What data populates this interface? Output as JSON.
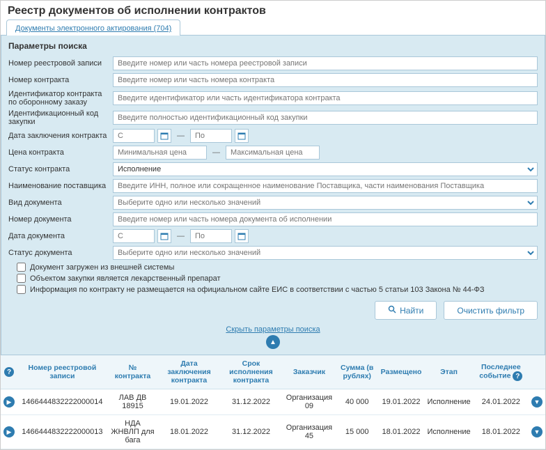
{
  "page_title": "Реестр документов об исполнении контрактов",
  "tab": {
    "label": "Документы электронного актирования (704)"
  },
  "search": {
    "heading": "Параметры поиска",
    "labels": {
      "registry_no": "Номер реестровой записи",
      "contract_no": "Номер контракта",
      "defense_id": "Идентификатор контракта по оборонному заказу",
      "purchase_code": "Идентификационный код закупки",
      "contract_date": "Дата заключения контракта",
      "price": "Цена контракта",
      "contract_status": "Статус контракта",
      "supplier": "Наименование поставщика",
      "doc_type": "Вид документа",
      "doc_no": "Номер документа",
      "doc_date": "Дата документа",
      "doc_status": "Статус документа"
    },
    "placeholders": {
      "registry_no": "Введите номер или часть номера реестровой записи",
      "contract_no": "Введите номер или часть номера контракта",
      "defense_id": "Введите идентификатор или часть идентификатора контракта",
      "purchase_code": "Введите полностью идентификационный код закупки",
      "date_from": "С",
      "date_to": "По",
      "price_min": "Минимальная цена",
      "price_max": "Максимальная цена",
      "supplier": "Введите ИНН, полное или сокращенное наименование Поставщика, части наименования Поставщика",
      "multi_select": "Выберите одно или несколько значений",
      "doc_no": "Введите номер или часть номера документа об исполнении"
    },
    "values": {
      "contract_status": "Исполнение"
    },
    "checkboxes": {
      "external": "Документ загружен из внешней системы",
      "medicine": "Объектом закупки является лекарственный препарат",
      "not_published": "Информация по контракту не размещается на официальном сайте ЕИС в соответствии с частью 5 статьи 103 Закона № 44-ФЗ"
    },
    "buttons": {
      "find": "Найти",
      "clear": "Очистить фильтр"
    },
    "collapse_label": "Скрыть параметры поиска"
  },
  "grid": {
    "headers": {
      "registry_no": "Номер реестровой записи",
      "contract_no": "№ контракта",
      "contract_date": "Дата заключения контракта",
      "exec_period": "Срок исполнения контракта",
      "customer": "Заказчик",
      "sum": "Сумма (в рублях)",
      "placed": "Размещено",
      "stage": "Этап",
      "last_event": "Последнее событие"
    },
    "rows": [
      {
        "registry_no": "1466444832222000014",
        "contract_no": "ЛАВ ДВ 18915",
        "contract_date": "19.01.2022",
        "exec_period": "31.12.2022",
        "customer": "Организация 09",
        "sum": "40 000",
        "placed": "19.01.2022",
        "stage": "Исполнение",
        "last_event": "24.01.2022"
      },
      {
        "registry_no": "1466444832222000013",
        "contract_no": "НДА ЖНВЛП для бага",
        "contract_date": "18.01.2022",
        "exec_period": "31.12.2022",
        "customer": "Организация 45",
        "sum": "15 000",
        "placed": "18.01.2022",
        "stage": "Исполнение",
        "last_event": "18.01.2022"
      }
    ]
  }
}
